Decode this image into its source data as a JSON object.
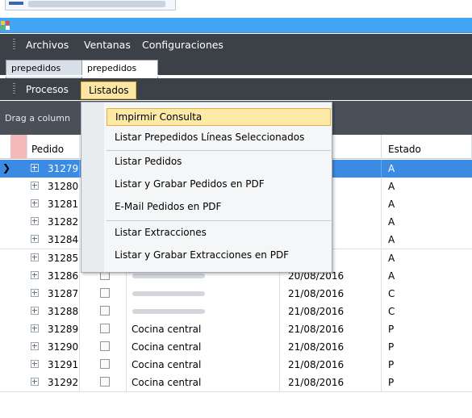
{
  "menubar": {
    "items": [
      "Archivos",
      "Ventanas",
      "Configuraciones"
    ]
  },
  "doc_tabs": [
    "prepedidos",
    "prepedidos"
  ],
  "menubar2": {
    "procesos": "Procesos",
    "listados": "Listados"
  },
  "group_panel": {
    "hint": "Drag a column"
  },
  "grid": {
    "headers": {
      "pedido": "Pedido",
      "estado": "Estado"
    },
    "rows": [
      {
        "id": "31279",
        "date": "16",
        "estado": "A",
        "cliente": "",
        "selected": true
      },
      {
        "id": "31280",
        "date": "16",
        "estado": "A",
        "cliente": ""
      },
      {
        "id": "31281",
        "date": "16",
        "estado": "A",
        "cliente": ""
      },
      {
        "id": "31282",
        "date": "16",
        "estado": "A",
        "cliente": ""
      },
      {
        "id": "31284",
        "date": "16",
        "estado": "A",
        "cliente": ""
      },
      {
        "id": "31285",
        "date": "16",
        "estado": "A",
        "cliente": ""
      },
      {
        "id": "31286",
        "date": "20/08/2016",
        "estado": "A",
        "cliente": ""
      },
      {
        "id": "31287",
        "date": "21/08/2016",
        "estado": "C",
        "cliente": ""
      },
      {
        "id": "31288",
        "date": "21/08/2016",
        "estado": "C",
        "cliente": ""
      },
      {
        "id": "31289",
        "date": "21/08/2016",
        "estado": "P",
        "cliente": "Cocina central"
      },
      {
        "id": "31290",
        "date": "21/08/2016",
        "estado": "P",
        "cliente": "Cocina central"
      },
      {
        "id": "31291",
        "date": "21/08/2016",
        "estado": "P",
        "cliente": "Cocina central"
      },
      {
        "id": "31292",
        "date": "21/08/2016",
        "estado": "P",
        "cliente": "Cocina central"
      }
    ]
  },
  "dropdown": {
    "items": [
      "Impirmir Consulta",
      "Listar Prepedidos Líneas Seleccionados",
      "Listar Pedidos",
      "Listar y Grabar Pedidos en PDF",
      "E-Mail Pedidos en PDF",
      "Listar Extracciones",
      "Listar y Grabar Extracciones en PDF"
    ]
  },
  "colors": {
    "titlebar": "#42a5f5",
    "menubar": "#3c4148",
    "selection": "#3b8be2",
    "highlight": "#fde9a8"
  }
}
